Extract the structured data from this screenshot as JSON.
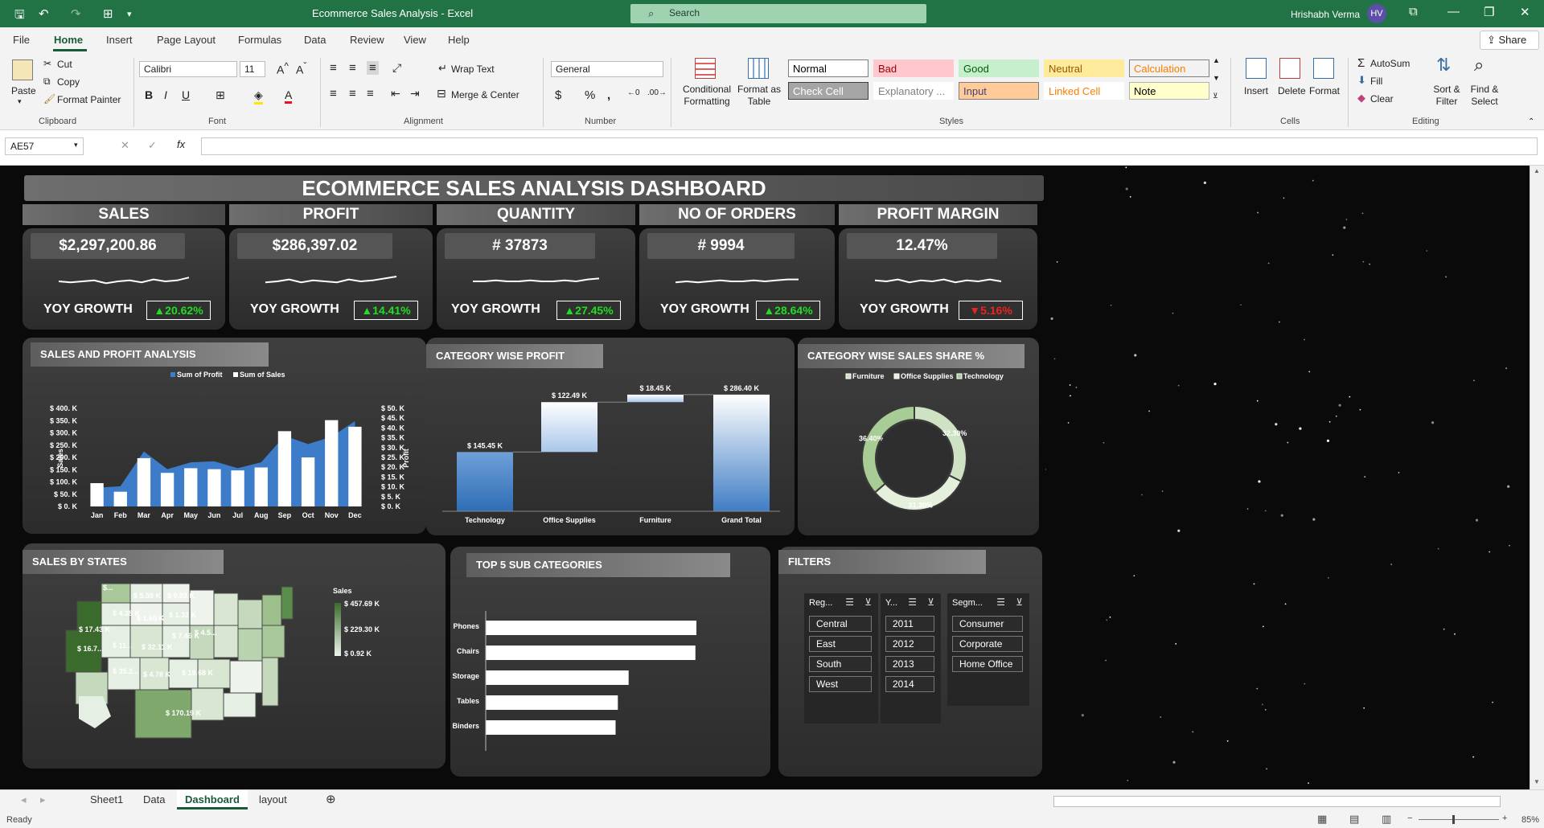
{
  "window": {
    "title": "Ecommerce Sales Analysis  -  Excel",
    "search_placeholder": "Search",
    "user_name": "Hrishabh Verma",
    "user_initials": "HV"
  },
  "menu": {
    "items": [
      "File",
      "Home",
      "Insert",
      "Page Layout",
      "Formulas",
      "Data",
      "Review",
      "View",
      "Help"
    ],
    "active": "Home",
    "share": "Share"
  },
  "ribbon": {
    "clipboard": {
      "paste": "Paste",
      "cut": "Cut",
      "copy": "Copy",
      "format_painter": "Format Painter",
      "label": "Clipboard"
    },
    "font": {
      "name": "Calibri",
      "size": "11",
      "label": "Font"
    },
    "alignment": {
      "wrap_text": "Wrap Text",
      "merge_center": "Merge & Center",
      "label": "Alignment"
    },
    "number": {
      "format": "General",
      "label": "Number"
    },
    "styles": {
      "conditional_formatting": "Conditional Formatting",
      "format_as_table": "Format as Table",
      "label": "Styles",
      "cells": [
        {
          "name": "Normal",
          "bg": "#ffffff",
          "fg": "#000000",
          "border": "#7d7d7d"
        },
        {
          "name": "Bad",
          "bg": "#ffc7ce",
          "fg": "#9c0006",
          "border": "#ffc7ce"
        },
        {
          "name": "Good",
          "bg": "#c6efce",
          "fg": "#006100",
          "border": "#c6efce"
        },
        {
          "name": "Neutral",
          "bg": "#ffeb9c",
          "fg": "#9c5700",
          "border": "#ffeb9c"
        },
        {
          "name": "Calculation",
          "bg": "#f2f2f2",
          "fg": "#fa7d00",
          "border": "#7f7f7f"
        },
        {
          "name": "Check Cell",
          "bg": "#a5a5a5",
          "fg": "#ffffff",
          "border": "#3f3f3f"
        },
        {
          "name": "Explanatory ...",
          "bg": "#ffffff",
          "fg": "#7f7f7f",
          "border": "#ffffff"
        },
        {
          "name": "Input",
          "bg": "#ffcc99",
          "fg": "#3f3f76",
          "border": "#7f7f7f"
        },
        {
          "name": "Linked Cell",
          "bg": "#ffffff",
          "fg": "#fa7d00",
          "border": "#ffffff"
        },
        {
          "name": "Note",
          "bg": "#ffffcc",
          "fg": "#000000",
          "border": "#b2b2b2"
        }
      ]
    },
    "cells": {
      "insert": "Insert",
      "delete": "Delete",
      "format": "Format",
      "label": "Cells"
    },
    "editing": {
      "autosum": "AutoSum",
      "fill": "Fill",
      "clear": "Clear",
      "sort_filter": "Sort & Filter",
      "find_select": "Find & Select",
      "label": "Editing"
    }
  },
  "formula_bar": {
    "name_box": "AE57",
    "formula": ""
  },
  "dashboard": {
    "title": "ECOMMERCE SALES ANALYSIS DASHBOARD",
    "kpis": [
      {
        "label": "SALES",
        "value": "$2,297,200.86",
        "yoy_label": "YOY GROWTH",
        "yoy": "▲20.62%",
        "yoy_color": "#22dd22"
      },
      {
        "label": "PROFIT",
        "value": "$286,397.02",
        "yoy_label": "YOY GROWTH",
        "yoy": "▲14.41%",
        "yoy_color": "#22dd22"
      },
      {
        "label": "QUANTITY",
        "value": "# 37873",
        "yoy_label": "YOY GROWTH",
        "yoy": "▲27.45%",
        "yoy_color": "#22dd22"
      },
      {
        "label": "NO OF ORDERS",
        "value": "# 9994",
        "yoy_label": "YOY GROWTH",
        "yoy": "▲28.64%",
        "yoy_color": "#22dd22"
      },
      {
        "label": "PROFIT MARGIN",
        "value": "12.47%",
        "yoy_label": "YOY GROWTH",
        "yoy": "▼5.16%",
        "yoy_color": "#ee2222"
      }
    ],
    "panels": {
      "sales_profit": "SALES AND PROFIT ANALYSIS",
      "category_profit": "CATEGORY WISE PROFIT",
      "category_share": "CATEGORY WISE SALES SHARE %",
      "sales_states": "SALES BY STATES",
      "top5": "TOP 5 SUB CATEGORIES",
      "filters": "FILTERS"
    },
    "map": {
      "legend_title": "Sales",
      "legend_max": "$ 457.69 K",
      "legend_mid": "$ 229.30 K",
      "legend_min": "$ 0.92 K",
      "labels": [
        "$...",
        "$ 17.43 K",
        "$ 5.59 K",
        "$ 0.92 K",
        "$ 4.38 K",
        "$ 1.60 K",
        "$ 1.32 K",
        "$ 16.7...",
        "$ 11...",
        "$ 7.46 K",
        "$ 4.5...",
        "$ 32.11 K",
        "$ 35.2...",
        "$ 4.78 K",
        "$ 19.68 K",
        "$ 170.19 K"
      ]
    },
    "slicers": [
      {
        "header": "Reg...",
        "items": [
          "Central",
          "East",
          "South",
          "West"
        ]
      },
      {
        "header": "Y...",
        "items": [
          "2011",
          "2012",
          "2013",
          "2014"
        ]
      },
      {
        "header": "Segm...",
        "items": [
          "Consumer",
          "Corporate",
          "Home Office"
        ]
      }
    ]
  },
  "chart_data": [
    {
      "type": "bar",
      "title": "SALES AND PROFIT ANALYSIS",
      "legend": [
        "Sum of Profit",
        "Sum of Sales"
      ],
      "categories": [
        "Jan",
        "Feb",
        "Mar",
        "Apr",
        "May",
        "Jun",
        "Jul",
        "Aug",
        "Sep",
        "Oct",
        "Nov",
        "Dec"
      ],
      "series": [
        {
          "name": "Sum of Sales",
          "type": "bar",
          "axis": "left",
          "values": [
            95,
            60,
            197,
            137,
            156,
            152,
            147,
            159,
            307,
            200,
            352,
            325
          ]
        },
        {
          "name": "Sum of Profit",
          "type": "area",
          "axis": "right",
          "values": [
            9.5,
            10.3,
            28.0,
            19.0,
            22.5,
            23.0,
            19.5,
            22.5,
            36.0,
            31.8,
            35.5,
            43.5
          ]
        }
      ],
      "ylabel": "Sales",
      "y2label": "Profit",
      "yticks": [
        "$ 0. K",
        "$ 50. K",
        "$ 100. K",
        "$ 150. K",
        "$ 200. K",
        "$ 250. K",
        "$ 300. K",
        "$ 350. K",
        "$ 400. K"
      ],
      "y2ticks": [
        "$ 0. K",
        "$ 5. K",
        "$ 10. K",
        "$ 15. K",
        "$ 20. K",
        "$ 25. K",
        "$ 30. K",
        "$ 35. K",
        "$ 40. K",
        "$ 45. K",
        "$ 50. K"
      ],
      "ylim": [
        0,
        400
      ],
      "y2lim": [
        0,
        50
      ]
    },
    {
      "type": "bar",
      "subtype": "waterfall",
      "title": "CATEGORY WISE PROFIT",
      "categories": [
        "Technology",
        "Office Supplies",
        "Furniture",
        "Grand Total"
      ],
      "values": [
        145.45,
        122.49,
        18.45,
        286.4
      ],
      "labels": [
        "$ 145.45 K",
        "$ 122.49 K",
        "$ 18.45 K",
        "$ 286.40 K"
      ],
      "ylim": [
        0,
        300
      ]
    },
    {
      "type": "pie",
      "subtype": "doughnut",
      "title": "CATEGORY WISE SALES SHARE %",
      "categories": [
        "Furniture",
        "Office Supplies",
        "Technology"
      ],
      "values": [
        32.3,
        31.3,
        36.4
      ],
      "labels": [
        "32.30%",
        "31.30%",
        "36.40%"
      ]
    },
    {
      "type": "bar",
      "orientation": "horizontal",
      "title": "TOP 5 SUB CATEGORIES",
      "categories": [
        "Phones",
        "Chairs",
        "Storage",
        "Tables",
        "Binders"
      ],
      "values": [
        330.01,
        328.45,
        223.84,
        206.97,
        203.41
      ],
      "labels": [
        "$ 330.01 k",
        "$ 328.45 k",
        "$ 223.84 k",
        "$ 206.97 k",
        "$ 203.41 k"
      ]
    }
  ],
  "sheet_tabs": [
    "Sheet1",
    "Data",
    "Dashboard",
    "layout"
  ],
  "active_tab": "Dashboard",
  "status": {
    "text": "Ready",
    "zoom": "85%"
  }
}
